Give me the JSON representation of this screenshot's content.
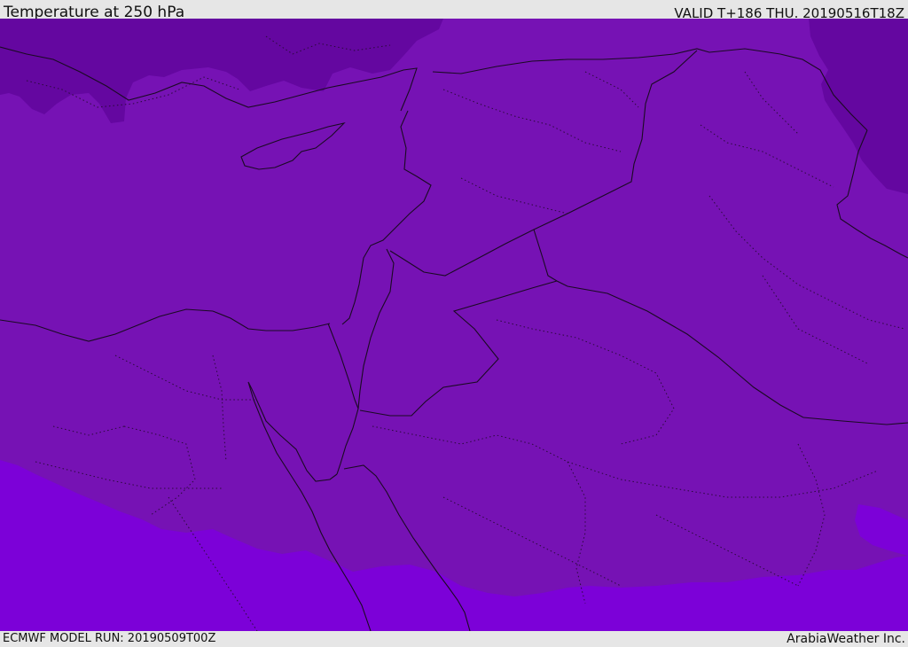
{
  "header": {
    "title": "Temperature at 250 hPa",
    "valid_time": "VALID T+186 THU. 20190516T18Z"
  },
  "footer": {
    "model_run": "ECMWF MODEL RUN: 20190509T00Z",
    "credit": "ArabiaWeather Inc."
  },
  "map": {
    "colors": {
      "base_band": "#7612b4",
      "cold_band": "#6407a0",
      "warm_band": "#7c01d8",
      "border_line": "#1a0a22",
      "admin_line": "#2a0a3a"
    }
  }
}
